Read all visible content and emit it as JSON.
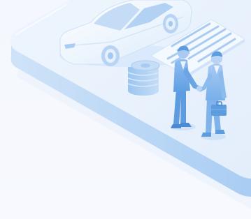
{
  "scene": {
    "subject": "car-loan-deal-illustration",
    "palette": {
      "background": "#f6f8fd",
      "platform_top": "#e8f1fc",
      "platform_side": "#b9d6f6",
      "accent": "#7fb3ea",
      "deep": "#5e9ce0"
    },
    "elements": [
      "car",
      "coin-stack",
      "contract-document",
      "businessman-left",
      "businessman-right",
      "briefcase"
    ]
  }
}
